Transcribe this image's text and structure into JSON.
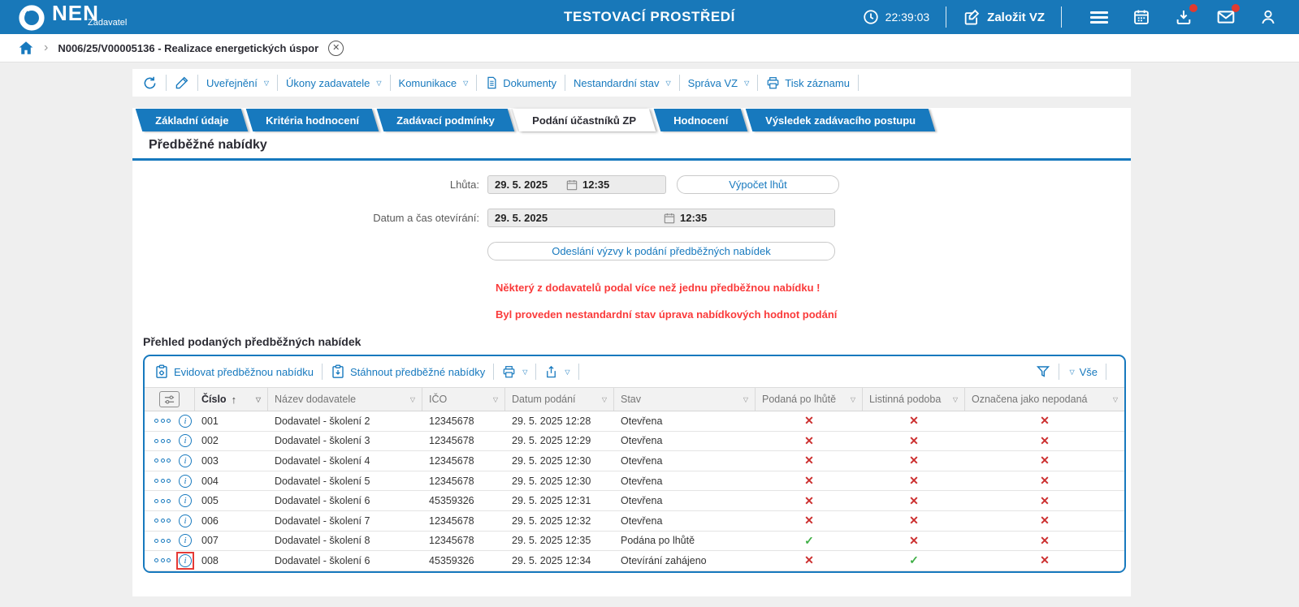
{
  "topbar": {
    "brand": "NEN",
    "brand_sub": "Zadavatel",
    "title": "TESTOVACÍ PROSTŘEDÍ",
    "time": "22:39:03",
    "create_vz": "Založit VZ"
  },
  "breadcrumb": {
    "item": "N006/25/V00005136 - Realizace energetických úspor"
  },
  "toolbar": {
    "uverejneni": "Uveřejnění",
    "ukony": "Úkony zadavatele",
    "komunikace": "Komunikace",
    "dokumenty": "Dokumenty",
    "nestandardni": "Nestandardní stav",
    "sprava": "Správa VZ",
    "tisk": "Tisk záznamu"
  },
  "tabs": [
    {
      "label": "Základní údaje",
      "active": false
    },
    {
      "label": "Kritéria hodnocení",
      "active": false
    },
    {
      "label": "Zadávací podmínky",
      "active": false
    },
    {
      "label": "Podání účastníků ZP",
      "active": true
    },
    {
      "label": "Hodnocení",
      "active": false
    },
    {
      "label": "Výsledek zadávacího postupu",
      "active": false
    }
  ],
  "section": {
    "title": "Předběžné nabídky"
  },
  "form": {
    "lhuta_label": "Lhůta:",
    "lhuta_date": "29. 5. 2025",
    "lhuta_time": "12:35",
    "vypocet_button": "Výpočet lhůt",
    "oteviranie_label": "Datum a čas otevírání:",
    "oteviranie_date": "29. 5. 2025",
    "oteviranie_time": "12:35",
    "send_button": "Odeslání výzvy k podání předběžných nabídek",
    "warning1": "Některý z dodavatelů podal více než jednu předběžnou nabídku !",
    "warning2": "Byl proveden nestandardní stav úprava nabídkových hodnot podání"
  },
  "table": {
    "title": "Přehled podaných předběžných nabídek",
    "toolbar": {
      "evidovat": "Evidovat předběžnou nabídku",
      "stahnout": "Stáhnout předběžné nabídky",
      "vse": "Vše"
    },
    "columns": [
      "Číslo",
      "Název dodavatele",
      "IČO",
      "Datum podání",
      "Stav",
      "Podaná po lhůtě",
      "Listinná podoba",
      "Označena jako nepodaná"
    ],
    "rows": [
      {
        "cislo": "001",
        "dodavatel": "Dodavatel - školení 2",
        "ico": "12345678",
        "datum": "29. 5. 2025 12:28",
        "stav": "Otevřena",
        "po_lhute": false,
        "listinna": false,
        "nepodana": false,
        "highlight_info": false
      },
      {
        "cislo": "002",
        "dodavatel": "Dodavatel - školení 3",
        "ico": "12345678",
        "datum": "29. 5. 2025 12:29",
        "stav": "Otevřena",
        "po_lhute": false,
        "listinna": false,
        "nepodana": false,
        "highlight_info": false
      },
      {
        "cislo": "003",
        "dodavatel": "Dodavatel - školení 4",
        "ico": "12345678",
        "datum": "29. 5. 2025 12:30",
        "stav": "Otevřena",
        "po_lhute": false,
        "listinna": false,
        "nepodana": false,
        "highlight_info": false
      },
      {
        "cislo": "004",
        "dodavatel": "Dodavatel - školení 5",
        "ico": "12345678",
        "datum": "29. 5. 2025 12:30",
        "stav": "Otevřena",
        "po_lhute": false,
        "listinna": false,
        "nepodana": false,
        "highlight_info": false
      },
      {
        "cislo": "005",
        "dodavatel": "Dodavatel - školení 6",
        "ico": "45359326",
        "datum": "29. 5. 2025 12:31",
        "stav": "Otevřena",
        "po_lhute": false,
        "listinna": false,
        "nepodana": false,
        "highlight_info": false
      },
      {
        "cislo": "006",
        "dodavatel": "Dodavatel - školení 7",
        "ico": "12345678",
        "datum": "29. 5. 2025 12:32",
        "stav": "Otevřena",
        "po_lhute": false,
        "listinna": false,
        "nepodana": false,
        "highlight_info": false
      },
      {
        "cislo": "007",
        "dodavatel": "Dodavatel - školení 8",
        "ico": "12345678",
        "datum": "29. 5. 2025 12:35",
        "stav": "Podána po lhůtě",
        "po_lhute": true,
        "listinna": false,
        "nepodana": false,
        "highlight_info": false
      },
      {
        "cislo": "008",
        "dodavatel": "Dodavatel - školení 6",
        "ico": "45359326",
        "datum": "29. 5. 2025 12:34",
        "stav": "Otevírání zahájeno",
        "po_lhute": false,
        "listinna": true,
        "nepodana": false,
        "highlight_info": true
      }
    ]
  },
  "icons": {
    "caret": "▽",
    "check": "✓",
    "cross": "✕",
    "sort_asc": "↑",
    "chevron": "›",
    "close": "✕"
  },
  "colors": {
    "primary_blue": "#1779be",
    "topbar_blue": "#1878b9",
    "warning_red": "#fa3a3a",
    "cross_red": "#cc2f2f",
    "check_green": "#3faf46",
    "highlight_red": "#e53935",
    "badge_red": "#e03a30"
  }
}
